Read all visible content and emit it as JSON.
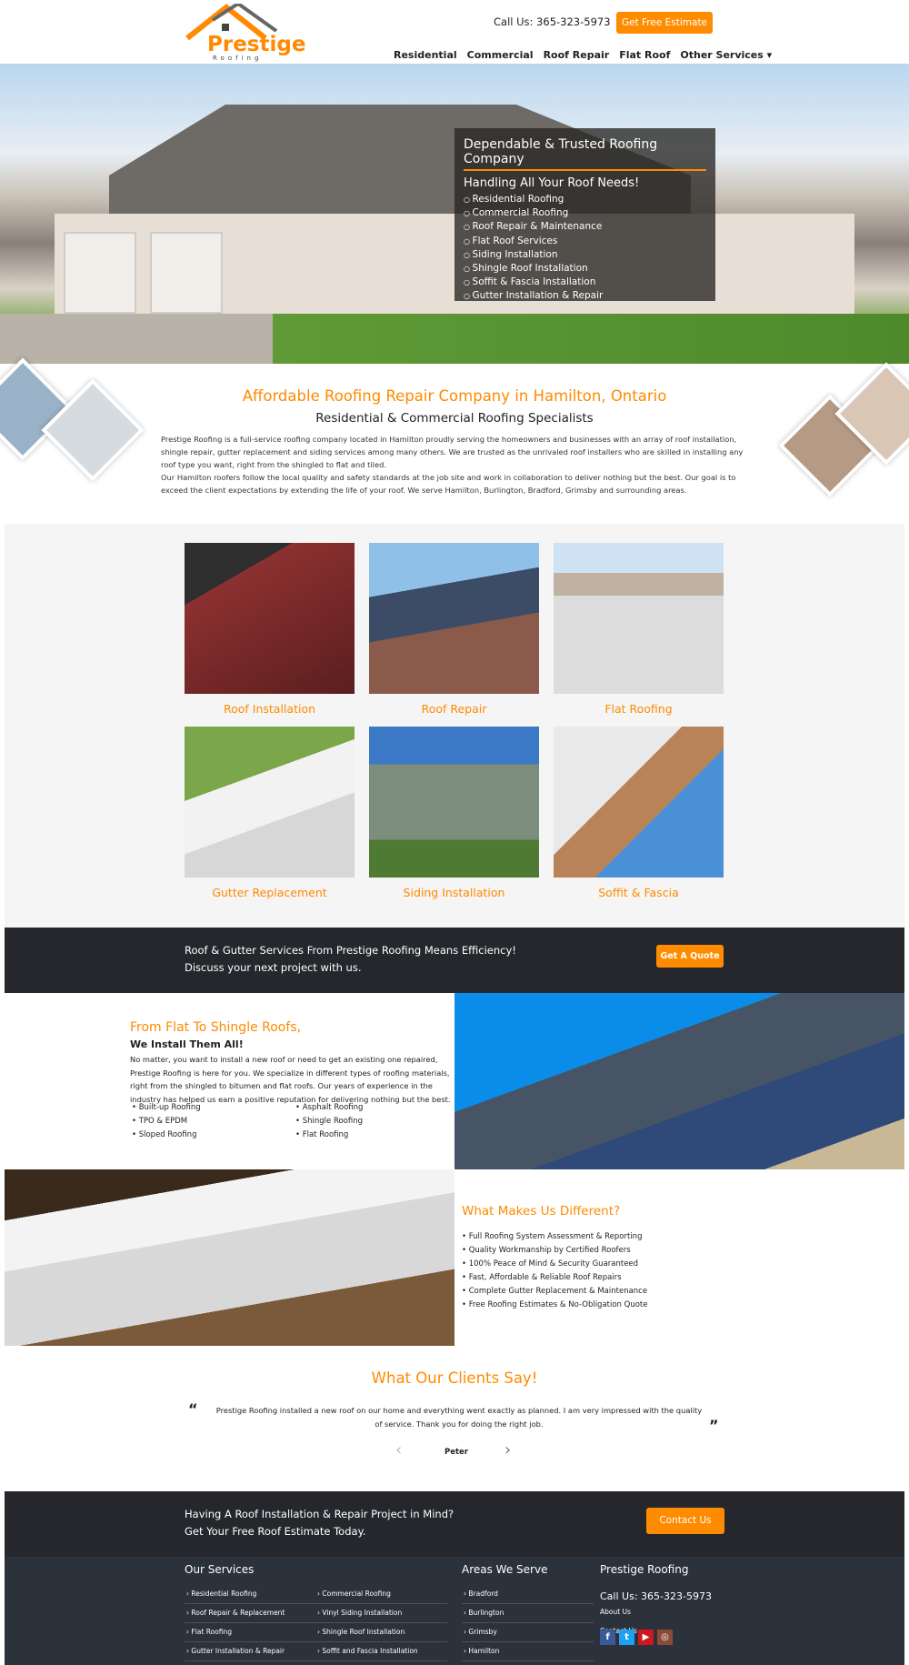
{
  "header": {
    "logo_name": "Prestige",
    "logo_sub": "Roofing",
    "call": "Call Us: 365-323-5973",
    "estimate_button": "Get Free Estimate",
    "nav": [
      "Residential",
      "Commercial",
      "Roof Repair",
      "Flat Roof",
      "Other Services ▾"
    ]
  },
  "hero": {
    "title": "Dependable & Trusted Roofing Company",
    "subtitle": "Handling All Your Roof Needs!",
    "items": [
      "Residential Roofing",
      "Commercial Roofing",
      "Roof Repair & Maintenance",
      "Flat Roof Services",
      "Siding Installation",
      "Shingle Roof Installation",
      "Soffit & Fascia Installation",
      "Gutter Installation & Repair"
    ]
  },
  "intro": {
    "title": "Affordable Roofing Repair Company in Hamilton, Ontario",
    "subtitle": "Residential & Commercial Roofing Specialists",
    "p1": "Prestige Roofing is a full-service roofing company located in Hamilton proudly serving the homeowners and businesses with an array of roof installation, shingle repair, gutter replacement and siding services among many others. We are trusted as the unrivaled roof installers who are skilled in installing any roof type you want, right from the shingled to flat and tiled.",
    "p2": "Our Hamilton roofers follow the local quality and safety standards at the job site and work in collaboration to deliver nothing but the best. Our goal is to exceed the client expectations by extending the life of your roof. We serve Hamilton, Burlington, Bradford, Grimsby and surrounding areas."
  },
  "services": [
    "Roof Installation",
    "Roof Repair",
    "Flat Roofing",
    "Gutter Replacement",
    "Siding Installation",
    "Soffit & Fascia"
  ],
  "band1": {
    "line1": "Roof & Gutter Services From Prestige Roofing Means Efficiency!",
    "line2": "Discuss your next project with us.",
    "button": "Get A Quote"
  },
  "install": {
    "title": "From Flat To Shingle Roofs,",
    "subtitle": "We Install Them All!",
    "text": "No matter, you want to install a new roof or need to get an existing one repaired, Prestige Roofing is here for you. We specialize in different types of roofing materials, right from the shingled to bitumen and flat roofs. Our years of experience in the industry has helped us earn a positive reputation for delivering nothing but the best.",
    "col1": [
      "Built-up Roofing",
      "TPO & EPDM",
      "Sloped Roofing"
    ],
    "col2": [
      "Asphalt Roofing",
      "Shingle Roofing",
      "Flat Roofing"
    ]
  },
  "different": {
    "title": "What Makes Us Different?",
    "items": [
      "Full Roofing System Assessment & Reporting",
      "Quality Workmanship by Certified Roofers",
      "100% Peace of Mind & Security Guaranteed",
      "Fast, Affordable & Reliable Roof Repairs",
      "Complete Gutter Replacement & Maintenance",
      "Free Roofing Estimates & No-Obligation Quote"
    ]
  },
  "testimonials": {
    "title": "What Our Clients Say!",
    "quote": "Prestige Roofing installed a new roof on our home and everything went exactly as planned. I am very impressed with the quality of service. Thank you for doing the right job.",
    "author": "Peter"
  },
  "band2": {
    "line1": "Having A Roof Installation & Repair Project in Mind?",
    "line2": "Get Your Free Roof Estimate Today.",
    "button": "Contact Us"
  },
  "footer": {
    "services_title": "Our Services",
    "services_col1": [
      "Residential Roofing",
      "Roof Repair & Replacement",
      "Flat Roofing",
      "Gutter Installation & Repair"
    ],
    "services_col2": [
      "Commercial Roofing",
      "Vinyl Siding Installation",
      "Shingle Roof Installation",
      "Soffit and Fascia Installation"
    ],
    "areas_title": "Areas We Serve",
    "areas": [
      "Bradford",
      "Burlington",
      "Grimsby",
      "Hamilton"
    ],
    "company_title": "Prestige Roofing",
    "call": "Call Us: 365-323-5973",
    "links": [
      "About Us",
      "Contact Us"
    ],
    "social": [
      {
        "icon": "facebook-icon",
        "glyph": "f",
        "color": "#3b5998"
      },
      {
        "icon": "twitter-icon",
        "glyph": "t",
        "color": "#1da1f2"
      },
      {
        "icon": "youtube-icon",
        "glyph": "▶",
        "color": "#cc181e"
      },
      {
        "icon": "instagram-icon",
        "glyph": "◎",
        "color": "#8a4a3a"
      }
    ]
  },
  "colors": {
    "accent": "#ff8c00",
    "dark_band": "#25272c",
    "footer": "#2b323b"
  }
}
